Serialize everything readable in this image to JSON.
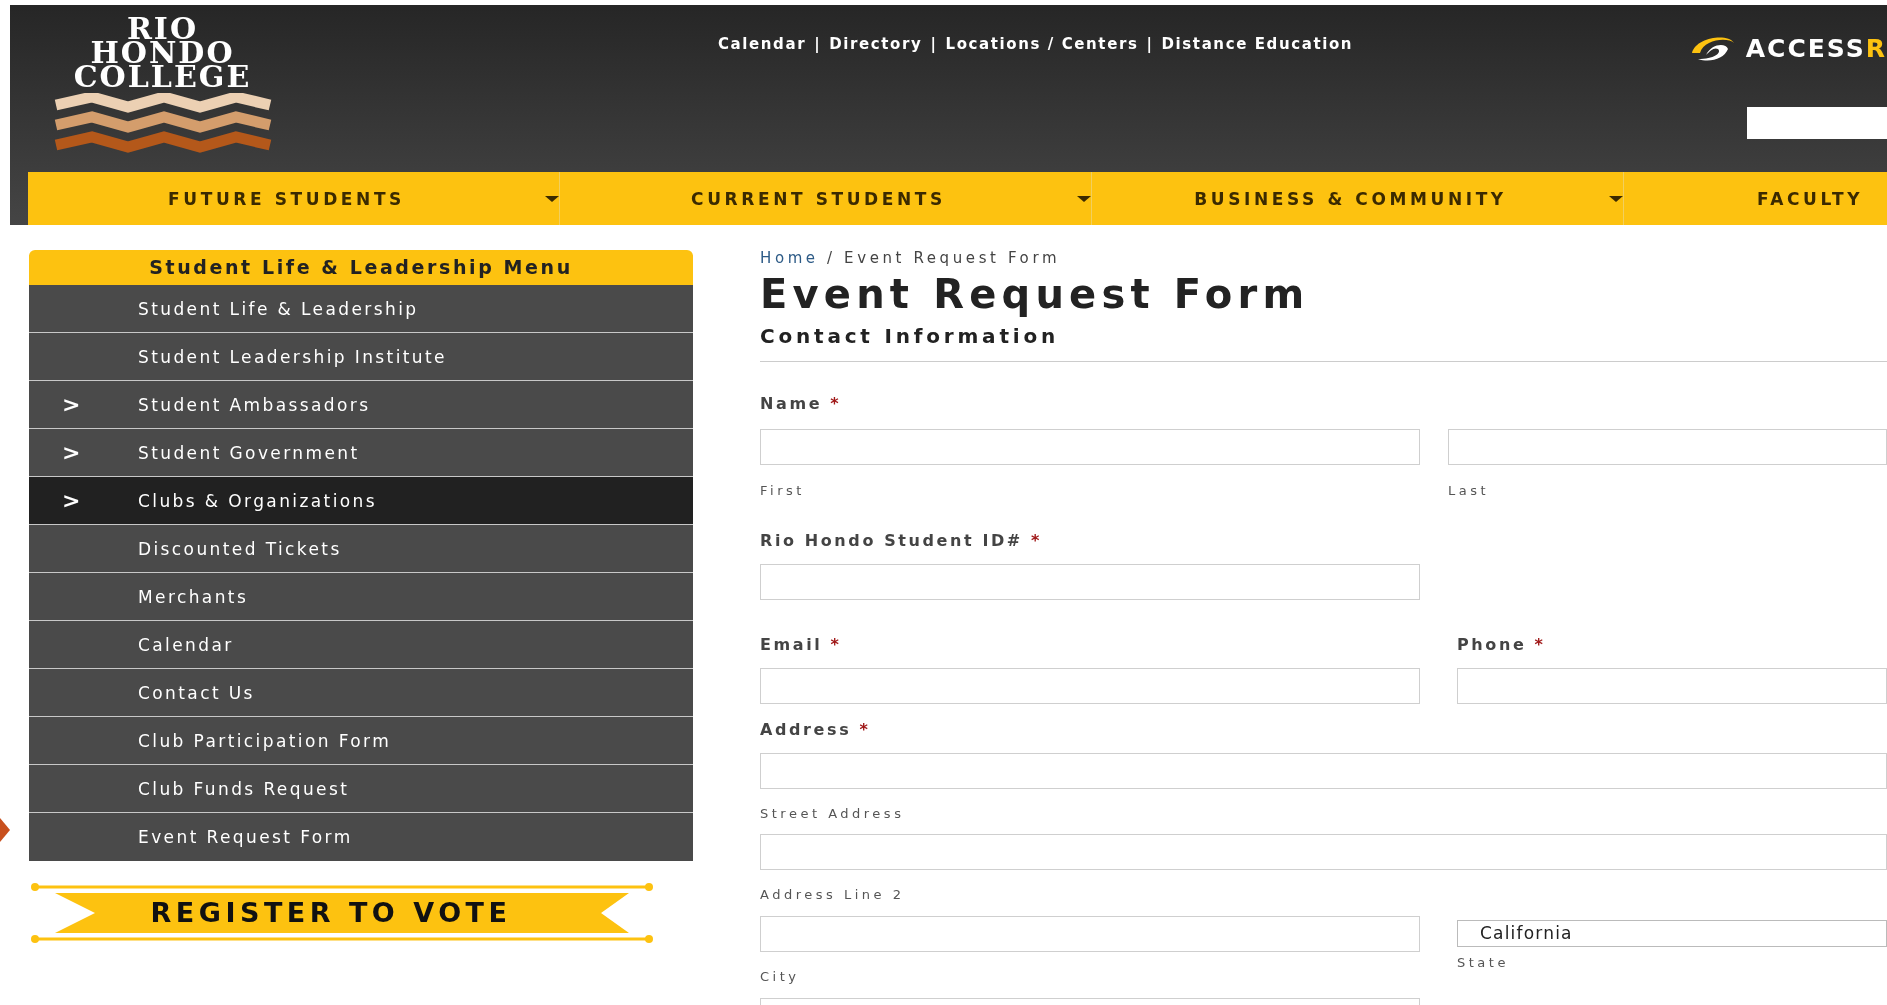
{
  "header": {
    "logo_lines": [
      "RIO",
      "HONDO",
      "COLLEGE"
    ],
    "top_links": [
      {
        "label": "Calendar"
      },
      {
        "label": "Directory"
      },
      {
        "label": "Locations / Centers"
      },
      {
        "label": "Distance Education"
      }
    ],
    "link_separator": "|",
    "access_logo": {
      "text": "ACCESS",
      "accent": "R"
    }
  },
  "nav": [
    {
      "label": "FUTURE STUDENTS",
      "has_caret": true
    },
    {
      "label": "CURRENT STUDENTS",
      "has_caret": true
    },
    {
      "label": "BUSINESS & COMMUNITY",
      "has_caret": true
    },
    {
      "label": "FACULTY",
      "has_caret": false
    }
  ],
  "sidebar": {
    "title": "Student Life & Leadership Menu",
    "items": [
      {
        "label": "Student Life & Leadership",
        "selected": false
      },
      {
        "label": "Student Leadership Institute",
        "selected": false
      },
      {
        "label": "Student Ambassadors",
        "marker": ">",
        "selected": false
      },
      {
        "label": "Student Government",
        "marker": ">",
        "selected": false
      },
      {
        "label": "Clubs & Organizations",
        "marker": ">",
        "selected": true
      },
      {
        "label": "Discounted Tickets",
        "selected": false
      },
      {
        "label": "Merchants",
        "selected": false
      },
      {
        "label": "Calendar",
        "selected": false
      },
      {
        "label": "Contact Us",
        "selected": false
      },
      {
        "label": "Club Participation Form",
        "selected": false
      },
      {
        "label": "Club Funds Request",
        "selected": false
      },
      {
        "label": "Event Request Form",
        "selected": false
      }
    ]
  },
  "banner": "REGISTER TO VOTE",
  "form": {
    "breadcrumb": {
      "home": "Home",
      "separator": "/",
      "current": "Event Request Form"
    },
    "title": "Event Request Form",
    "section": "Contact Information",
    "fields": [
      {
        "kind": "name",
        "label": "Name",
        "required_mark": "*",
        "parts": [
          {
            "sublabel": "First"
          },
          {
            "sublabel": "Last"
          }
        ]
      },
      {
        "kind": "single",
        "label": "Rio Hondo Student ID#",
        "required_mark": "*"
      },
      {
        "kind": "pair",
        "items": [
          {
            "label": "Email",
            "required_mark": "*"
          },
          {
            "label": "Phone",
            "required_mark": "*"
          }
        ]
      },
      {
        "kind": "address",
        "label": "Address",
        "required_mark": "*",
        "street": "Street Address",
        "line2": "Address Line 2",
        "city": "City",
        "state": {
          "value": "California",
          "sublabel": "State"
        }
      },
      {
        "kind": "bare"
      }
    ]
  }
}
